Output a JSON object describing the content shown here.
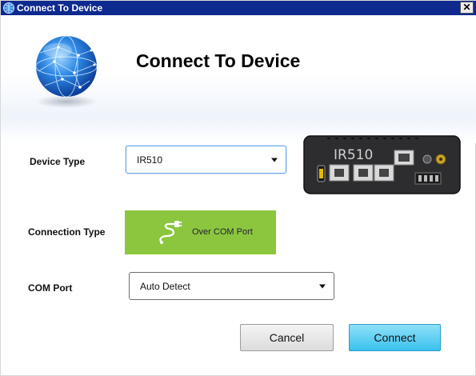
{
  "window": {
    "title": "Connect To Device",
    "close_label": "✕"
  },
  "header": {
    "title": "Connect To Device"
  },
  "device_type": {
    "label": "Device Type",
    "value": "IR510",
    "image_model_text": "IR510"
  },
  "connection_type": {
    "label": "Connection Type",
    "option_label": "Over COM Port",
    "accent_color": "#8cc63f"
  },
  "com_port": {
    "label": "COM Port",
    "value": "Auto Detect"
  },
  "buttons": {
    "cancel": "Cancel",
    "connect": "Connect"
  },
  "icons": {
    "window": "globe-app-icon",
    "header": "globe-icon",
    "connection": "plug-cable-icon",
    "dropdown": "chevron-down-icon"
  }
}
